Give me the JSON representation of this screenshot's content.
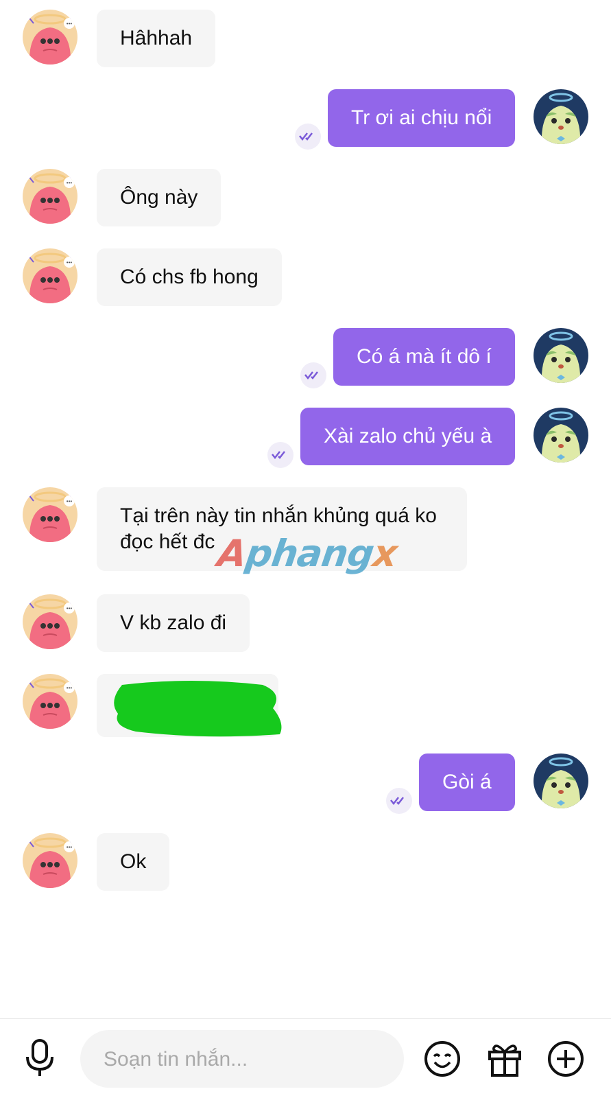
{
  "messages": [
    {
      "sender": "them",
      "text": "Hâhhah"
    },
    {
      "sender": "me",
      "text": "Tr ơi ai chịu nổi",
      "status": "read"
    },
    {
      "sender": "them",
      "text": "Ông này"
    },
    {
      "sender": "them",
      "text": "Có chs fb hong"
    },
    {
      "sender": "me",
      "text": "Có á mà ít dô í",
      "status": "read"
    },
    {
      "sender": "me",
      "text": "Xài zalo chủ yếu à",
      "status": "read"
    },
    {
      "sender": "them",
      "text": "Tại trên này tin nhắn khủng quá ko đọc hết đc"
    },
    {
      "sender": "them",
      "text": "V kb zalo đi"
    },
    {
      "sender": "them",
      "text": "",
      "redacted": true
    },
    {
      "sender": "me",
      "text": "Gòi á",
      "status": "read"
    },
    {
      "sender": "them",
      "text": "Ok"
    }
  ],
  "watermark": {
    "part1": "A",
    "part2": "phang",
    "part3": "x"
  },
  "composer": {
    "placeholder": "Soạn tin nhắn..."
  },
  "icons": {
    "mic": "microphone-icon",
    "emoji": "emoji-icon",
    "gift": "gift-icon",
    "add": "plus-circle-icon",
    "read": "double-check-icon"
  },
  "colors": {
    "outgoing_bubble": "#9266ea",
    "incoming_bubble": "#f5f5f5",
    "redaction": "#16c91d",
    "read_check": "#7a5ad8"
  }
}
